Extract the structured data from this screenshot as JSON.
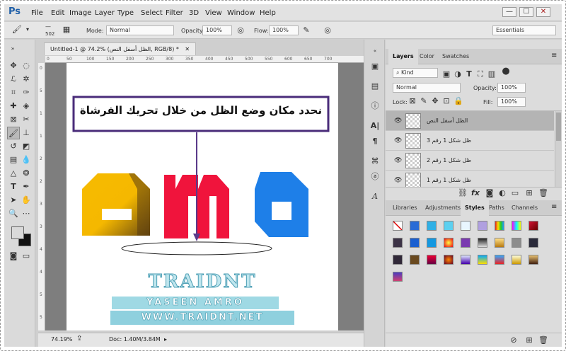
{
  "app": {
    "logo": "Ps"
  },
  "menu": [
    "File",
    "Edit",
    "Image",
    "Layer",
    "Type",
    "Select",
    "Filter",
    "3D",
    "View",
    "Window",
    "Help"
  ],
  "window_controls": [
    "—",
    "☐",
    "✕"
  ],
  "options": {
    "brush_size": "502",
    "mode_label": "Mode:",
    "mode": "Normal",
    "opacity_label": "Opacity:",
    "opacity": "100%",
    "flow_label": "Flow:",
    "flow": "100%",
    "workspace": "Essentials"
  },
  "document": {
    "tab": "Untitled-1 @ 74.2% (الظل أسفل النص, RGB/8) *",
    "zoom": "74.19%",
    "doc_size": "Doc: 1.40M/3.84M",
    "ruler_h": [
      "0",
      "50",
      "100",
      "150",
      "200",
      "250",
      "300",
      "350",
      "400",
      "450",
      "500",
      "550",
      "600",
      "650",
      "700"
    ],
    "ruler_v": [
      "0",
      "5",
      "1",
      "1",
      "2",
      "2",
      "3",
      "3",
      "4",
      "4",
      "5",
      "5"
    ]
  },
  "canvas": {
    "callout": "نحدد مكان وضع الظل من خلال تحريك الفرشاة",
    "wm_logo": "TRAIDNT",
    "wm_name": "YASEEN AMRO",
    "wm_url": "WWW.TRAIDNT.NET"
  },
  "colors": {
    "yellow": "#f7bb00",
    "red": "#f0143c",
    "blue": "#1e7fe8",
    "callout_border": "#4a2c7a",
    "arrow": "#5a3a8a"
  },
  "layers_panel": {
    "tabs": [
      "Layers",
      "Color",
      "Swatches"
    ],
    "kind": "Kind",
    "blend": "Normal",
    "opacity_label": "Opacity:",
    "opacity": "100%",
    "lock_label": "Lock:",
    "fill_label": "Fill:",
    "fill": "100%",
    "layers": [
      "الظل أسفل النص",
      "ظل شكل 1 رقم 3",
      "ظل شكل 1 رقم 2",
      "ظل شكل 1 رقم 1"
    ]
  },
  "styles_panel": {
    "tabs": [
      "Libraries",
      "Adjustments",
      "Styles",
      "Paths",
      "Channels"
    ]
  },
  "icons": [
    "brush-icon",
    "move-icon",
    "eye-icon",
    "lock-icon",
    "trash-icon",
    "gear-icon"
  ]
}
